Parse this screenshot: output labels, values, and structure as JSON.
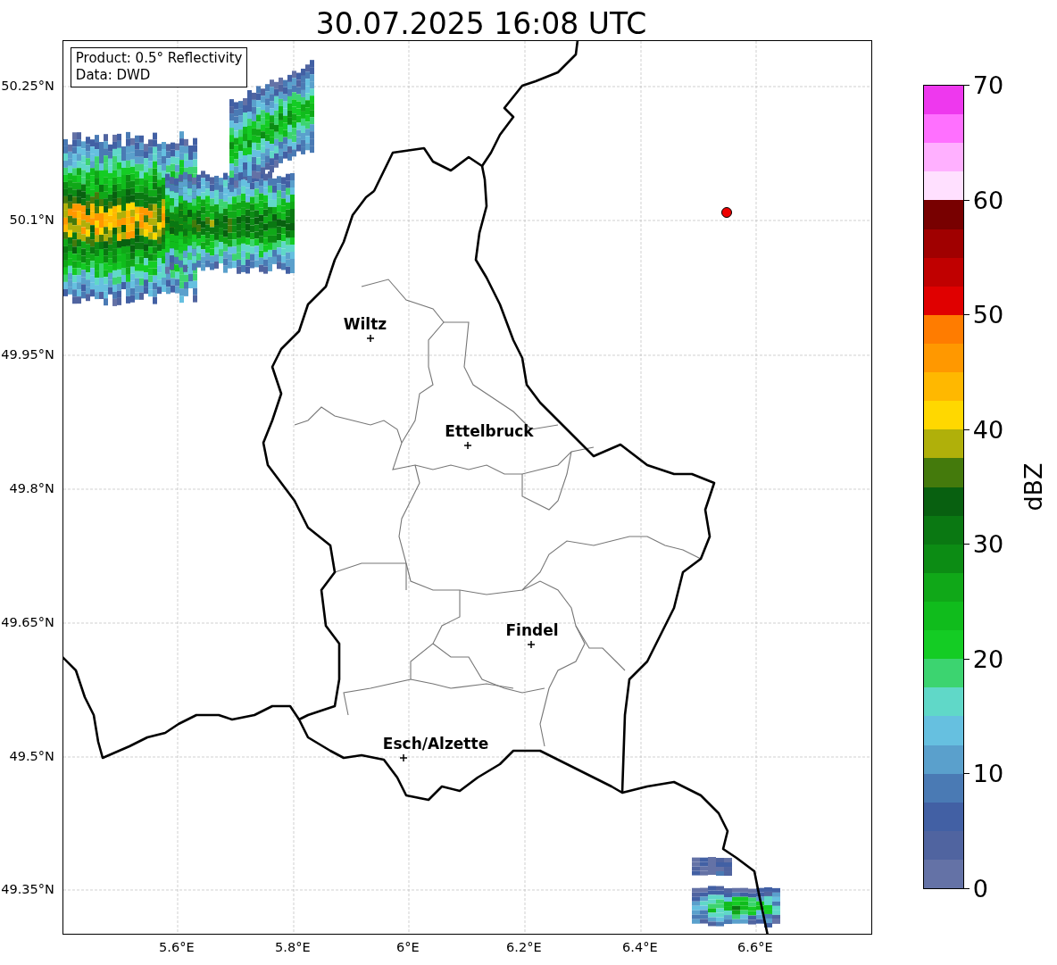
{
  "title": "30.07.2025 16:08 UTC",
  "info_box": {
    "lines": [
      "Product: 0.5° Reflectivity",
      "Data: DWD"
    ]
  },
  "map": {
    "y_ticks": [
      "50.25°N",
      "50.1°N",
      "49.95°N",
      "49.8°N",
      "49.65°N",
      "49.5°N",
      "49.35°N"
    ],
    "x_ticks": [
      "5.6°E",
      "5.8°E",
      "6°E",
      "6.2°E",
      "6.4°E",
      "6.6°E"
    ],
    "places": [
      {
        "name": "Wiltz"
      },
      {
        "name": "Ettelbruck"
      },
      {
        "name": "Findel"
      },
      {
        "name": "Esch/Alzette"
      }
    ]
  },
  "colorbar": {
    "label": "dBZ",
    "ticks": [
      "70",
      "60",
      "50",
      "40",
      "30",
      "20",
      "10",
      "0"
    ],
    "segments": [
      {
        "color": "#ee38ee"
      },
      {
        "color": "#ff70ff"
      },
      {
        "color": "#ffb0ff"
      },
      {
        "color": "#ffe0ff"
      },
      {
        "color": "#780000"
      },
      {
        "color": "#a00000"
      },
      {
        "color": "#c00000"
      },
      {
        "color": "#e00000"
      },
      {
        "color": "#ff7c00"
      },
      {
        "color": "#ff9800"
      },
      {
        "color": "#ffb800"
      },
      {
        "color": "#ffd800"
      },
      {
        "color": "#b0b00a"
      },
      {
        "color": "#447a0c"
      },
      {
        "color": "#086010"
      },
      {
        "color": "#0a7812"
      },
      {
        "color": "#0c8c14"
      },
      {
        "color": "#10a818"
      },
      {
        "color": "#10bc1c"
      },
      {
        "color": "#14cc24"
      },
      {
        "color": "#3cd470"
      },
      {
        "color": "#60d8c8"
      },
      {
        "color": "#66c0e0"
      },
      {
        "color": "#5aa0cc"
      },
      {
        "color": "#4a7ab4"
      },
      {
        "color": "#4260a4"
      },
      {
        "color": "#5064a0"
      },
      {
        "color": "#6472a6"
      }
    ]
  }
}
